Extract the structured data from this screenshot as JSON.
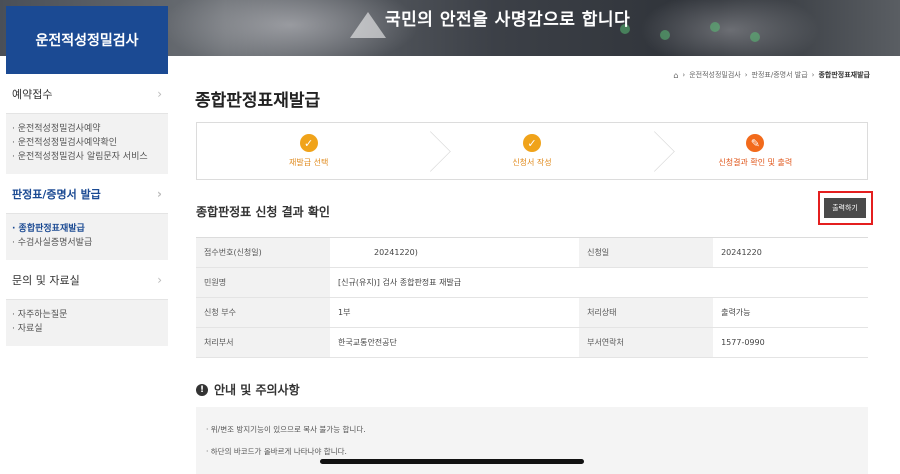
{
  "banner": {
    "slogan": "국민의 안전을 사명감으로 합니다"
  },
  "sidebar": {
    "title": "운전적성정밀검사",
    "sections": [
      {
        "label": "예약접수",
        "chevron": "›",
        "active": false,
        "items": [
          {
            "label": "· 운전적성정밀검사예약",
            "active": false
          },
          {
            "label": "· 운전적성정밀검사예약확인",
            "active": false
          },
          {
            "label": "· 운전적성정밀검사 알림문자 서비스",
            "active": false
          }
        ]
      },
      {
        "label": "판정표/증명서 발급",
        "chevron": "›",
        "active": true,
        "items": [
          {
            "label": "· 종합판정표재발급",
            "active": true
          },
          {
            "label": "· 수검사실증명서발급",
            "active": false
          }
        ]
      },
      {
        "label": "문의 및 자료실",
        "chevron": "›",
        "active": false,
        "items": [
          {
            "label": "· 자주하는질문",
            "active": false
          },
          {
            "label": "· 자료실",
            "active": false
          }
        ]
      }
    ]
  },
  "breadcrumb": {
    "home_icon": "home-icon",
    "items": [
      "운전적성정밀검사",
      "판정표/증명서 발급",
      "종합판정표재발급"
    ],
    "separator": "›"
  },
  "page_title": "종합판정표재발급",
  "steps": [
    {
      "label": "재발급 선택",
      "icon": "check-icon",
      "glyph": "✓",
      "current": false
    },
    {
      "label": "신청서 작성",
      "icon": "check-icon",
      "glyph": "✓",
      "current": false
    },
    {
      "label": "신청결과 확인 및 출력",
      "icon": "pencil-icon",
      "glyph": "✎",
      "current": true
    }
  ],
  "result": {
    "title": "종합판정표 신청 결과 확인",
    "print_label": "출력하기"
  },
  "table": {
    "rows": [
      [
        "접수번호(신청일)",
        "20241220)",
        "신청일",
        "20241220"
      ],
      [
        "민원명",
        "[신규(유지)] 검사 종합판정표 재발급"
      ],
      [
        "신청 부수",
        "1부",
        "처리상태",
        "출력가능"
      ],
      [
        "처리부서",
        "한국교통안전공단",
        "부서연락처",
        "1577-0990"
      ]
    ]
  },
  "notice": {
    "title": "안내 및 주의사항",
    "lines": [
      "· 위/변조 방지기능이 있으므로 복사 불가능 합니다.",
      "· 하단의 바코드가 올바르게 나타나야 합니다."
    ]
  },
  "colors": {
    "brand": "#1b4a93",
    "step": "#f0a31a",
    "step_current": "#f26a1b",
    "highlight": "#e41f1f"
  }
}
